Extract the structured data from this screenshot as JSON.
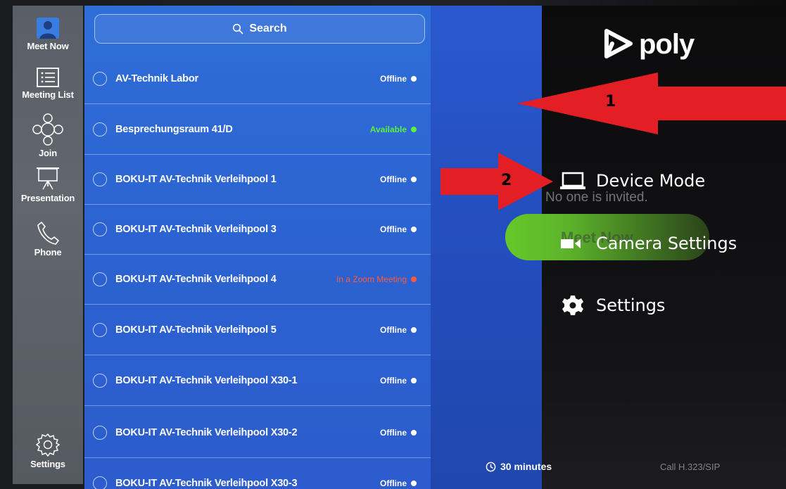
{
  "nav": {
    "items": [
      {
        "label": "Meet Now",
        "icon": "meet-now-icon"
      },
      {
        "label": "Meeting List",
        "icon": "meeting-list-icon"
      },
      {
        "label": "Join",
        "icon": "join-icon"
      },
      {
        "label": "Presentation",
        "icon": "presentation-icon"
      },
      {
        "label": "Phone",
        "icon": "phone-icon"
      }
    ],
    "settings": {
      "label": "Settings",
      "icon": "settings-gear-icon"
    }
  },
  "search": {
    "label": "Search"
  },
  "rooms": [
    {
      "name": "AV-Technik Labor",
      "status": "Offline",
      "status_color": "#ffffff"
    },
    {
      "name": "Besprechungsraum 41/D",
      "status": "Available",
      "status_color": "#5cf03c"
    },
    {
      "name": "BOKU-IT AV-Technik Verleihpool 1",
      "status": "Offline",
      "status_color": "#ffffff"
    },
    {
      "name": "BOKU-IT AV-Technik Verleihpool 3",
      "status": "Offline",
      "status_color": "#ffffff"
    },
    {
      "name": "BOKU-IT AV-Technik Verleihpool 4",
      "status": "In a Zoom Meeting",
      "status_color": "#ff5a3c"
    },
    {
      "name": "BOKU-IT AV-Technik Verleihpool 5",
      "status": "Offline",
      "status_color": "#ffffff"
    },
    {
      "name": "BOKU-IT AV-Technik Verleihpool X30-1",
      "status": "Offline",
      "status_color": "#ffffff"
    },
    {
      "name": "BOKU-IT AV-Technik Verleihpool X30-2",
      "status": "Offline",
      "status_color": "#ffffff"
    },
    {
      "name": "BOKU-IT AV-Technik Verleihpool X30-3",
      "status": "Offline",
      "status_color": "#ffffff"
    }
  ],
  "brand": {
    "name": "poly"
  },
  "background": {
    "invite_text": "No one is invited.",
    "meet_now_button": "Meet Now"
  },
  "poly_menu": {
    "items": [
      {
        "label": "Device Mode",
        "icon": "laptop-icon"
      },
      {
        "label": "Camera Settings",
        "icon": "camera-icon"
      },
      {
        "label": "Settings",
        "icon": "gear-icon"
      }
    ]
  },
  "footer": {
    "duration": "30 minutes",
    "call_type": "Call H.323/SIP"
  },
  "annotations": [
    {
      "label": "1",
      "color": "#e31e24"
    },
    {
      "label": "2",
      "color": "#e31e24"
    }
  ]
}
